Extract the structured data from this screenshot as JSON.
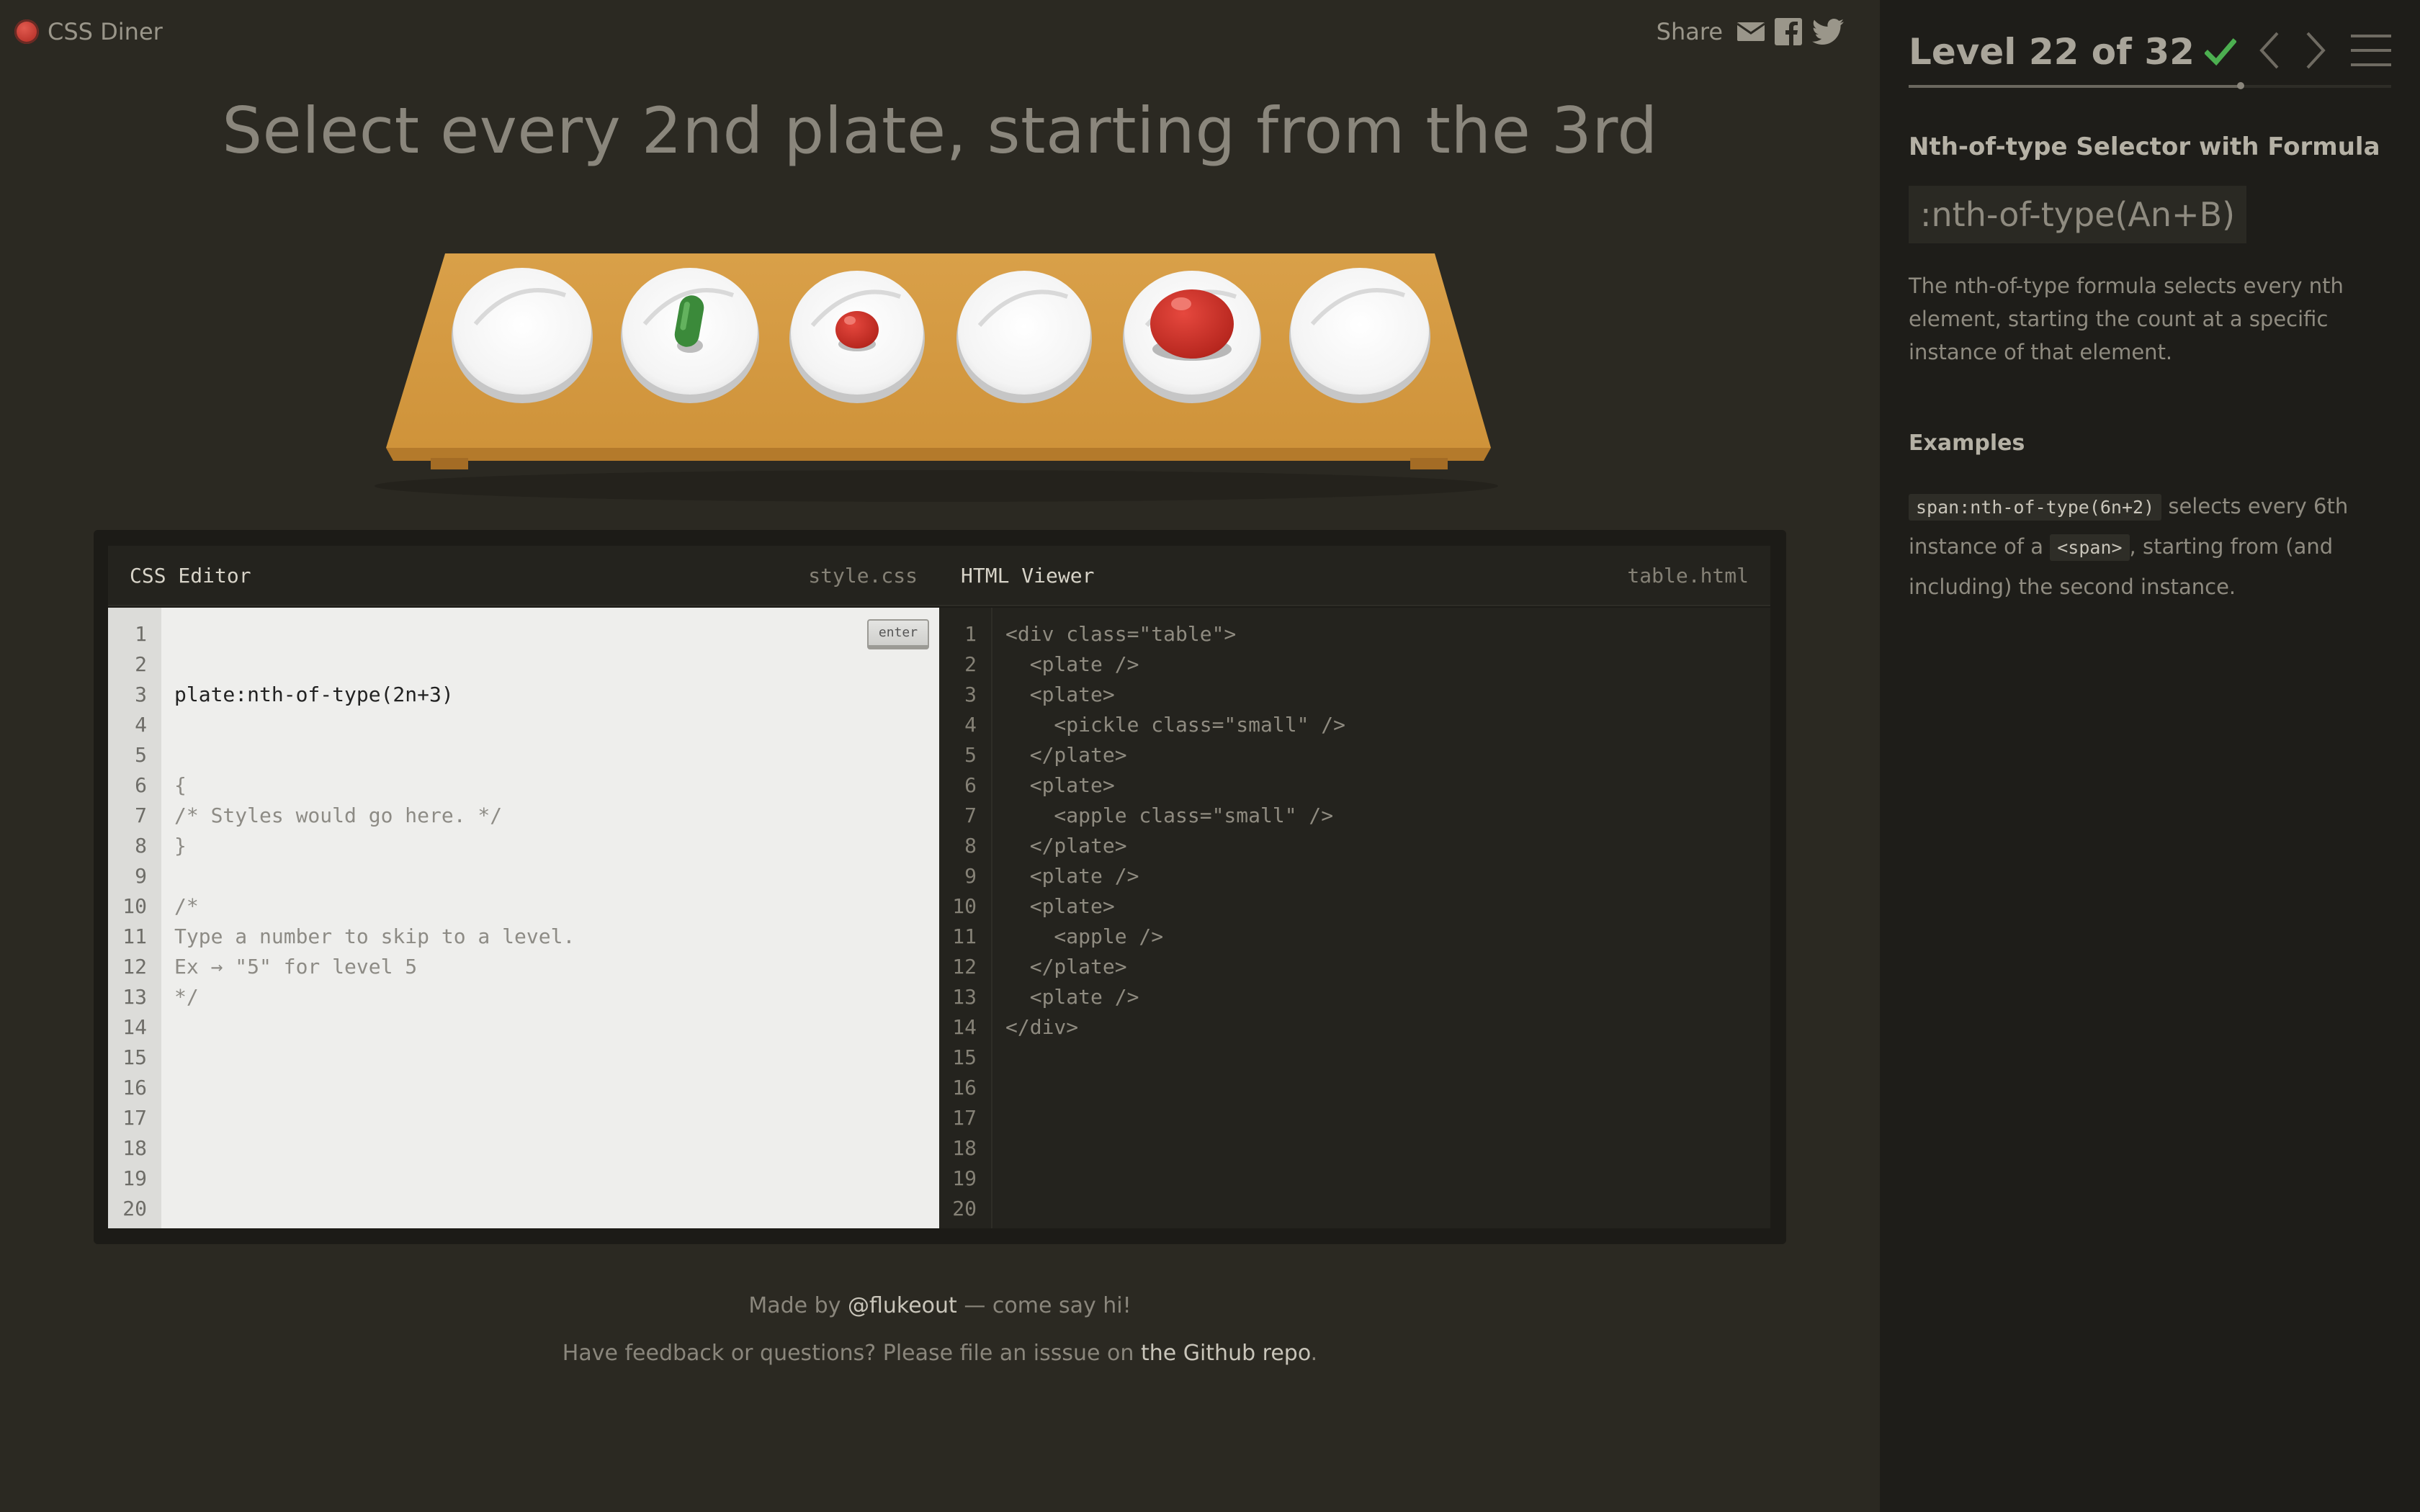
{
  "app": {
    "logo_text": "CSS Diner"
  },
  "share": {
    "label": "Share",
    "icons": [
      "email-icon",
      "facebook-icon",
      "twitter-icon"
    ]
  },
  "headline": "Select every 2nd plate, starting from the 3rd",
  "table_items": [
    {
      "type": "plate",
      "content": ""
    },
    {
      "type": "plate",
      "content": "pickle small"
    },
    {
      "type": "plate",
      "content": "apple small"
    },
    {
      "type": "plate",
      "content": ""
    },
    {
      "type": "plate",
      "content": "apple"
    },
    {
      "type": "plate",
      "content": ""
    }
  ],
  "css_editor": {
    "title": "CSS Editor",
    "filename": "style.css",
    "enter_label": "enter",
    "input_value": "plate:nth-of-type(2n+3)",
    "lines": [
      "{",
      "/* Styles would go here. */",
      "}",
      "",
      "/*",
      "Type a number to skip to a level.",
      "Ex → \"5\" for level 5",
      "*/"
    ],
    "line_numbers": [
      "1",
      "2",
      "3",
      "4",
      "5",
      "6",
      "7",
      "8",
      "9",
      "10",
      "11",
      "12",
      "13",
      "14",
      "15",
      "16",
      "17",
      "18",
      "19",
      "20"
    ]
  },
  "html_viewer": {
    "title": "HTML Viewer",
    "filename": "table.html",
    "lines": [
      "<div class=\"table\">",
      "  <plate />",
      "  <plate>",
      "    <pickle class=\"small\" />",
      "  </plate>",
      "  <plate>",
      "    <apple class=\"small\" />",
      "  </plate>",
      "  <plate />",
      "  <plate>",
      "    <apple />",
      "  </plate>",
      "  <plate />",
      "</div>"
    ],
    "line_numbers": [
      "1",
      "2",
      "3",
      "4",
      "5",
      "6",
      "7",
      "8",
      "9",
      "10",
      "11",
      "12",
      "13",
      "14",
      "15",
      "16",
      "17",
      "18",
      "19",
      "20"
    ]
  },
  "footer": {
    "made_by_prefix": "Made by ",
    "made_by_link": "@flukeout",
    "made_by_suffix": " — come say hi!",
    "feedback_prefix": "Have feedback or questions? Please file an isssue on ",
    "feedback_link": "the Github repo",
    "feedback_suffix": "."
  },
  "sidebar": {
    "level_label": "Level 22 of 32",
    "progress_fraction": 0.6875,
    "selector_name": "Nth-of-type Selector with Formula",
    "syntax": ":nth-of-type(An+B)",
    "description": "The nth-of-type formula selects every nth element, starting the count at a specific instance of that element.",
    "examples_heading": "Examples",
    "example": {
      "code1": "span:nth-of-type(6n+2)",
      "text1": " selects every 6th instance of a ",
      "code2": "<span>",
      "text2": ", starting from (and including) the second instance."
    }
  },
  "colors": {
    "background": "#2b2922",
    "sidebar": "#1e1d19",
    "check": "#4caf50",
    "apple": "#c62f27",
    "pickle": "#3b8a3a",
    "table": "#d39a42"
  }
}
